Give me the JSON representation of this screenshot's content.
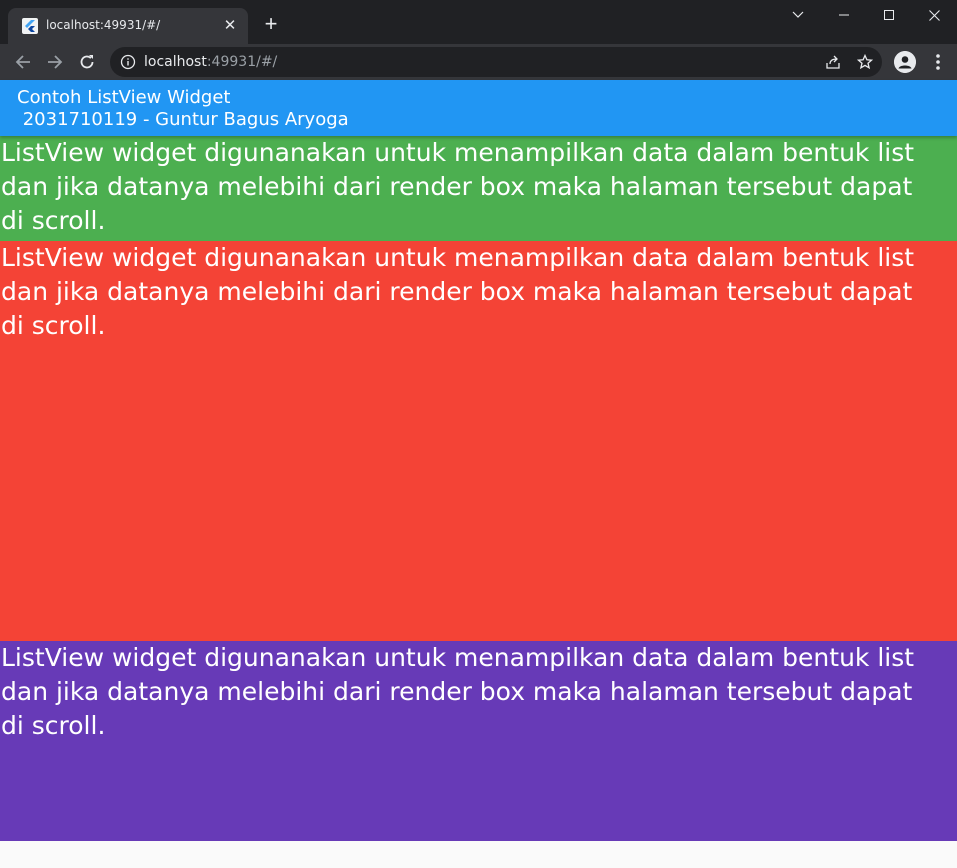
{
  "browser": {
    "tab_title": "localhost:49931/#/",
    "new_tab_symbol": "+",
    "url_host": "localhost",
    "url_rest": ":49931/#/"
  },
  "app": {
    "appbar_color": "#2196f3",
    "title_line1": "Contoh ListView Widget",
    "title_line2": " 2031710119 - Guntur Bagus Aryoga"
  },
  "list": {
    "items": [
      {
        "color": "#4caf50",
        "text": "ListView widget digunanakan untuk menampilkan data dalam bentuk list dan jika datanya melebihi dari render box maka halaman tersebut dapat di scroll."
      },
      {
        "color": "#f44336",
        "text": "ListView widget digunanakan untuk menampilkan data dalam bentuk list dan jika datanya melebihi dari render box maka halaman tersebut dapat di scroll."
      },
      {
        "color": "#673ab7",
        "text": "ListView widget digunanakan untuk menampilkan data dalam bentuk list dan jika datanya melebihi dari render box maka halaman tersebut dapat di scroll."
      }
    ]
  },
  "icons": [
    "flutter-favicon-icon",
    "close-icon",
    "plus-icon",
    "chevron-down-icon",
    "minimize-icon",
    "maximize-icon",
    "window-close-icon",
    "back-arrow-icon",
    "forward-arrow-icon",
    "reload-icon",
    "info-icon",
    "share-icon",
    "star-icon",
    "profile-icon",
    "more-vert-icon"
  ]
}
